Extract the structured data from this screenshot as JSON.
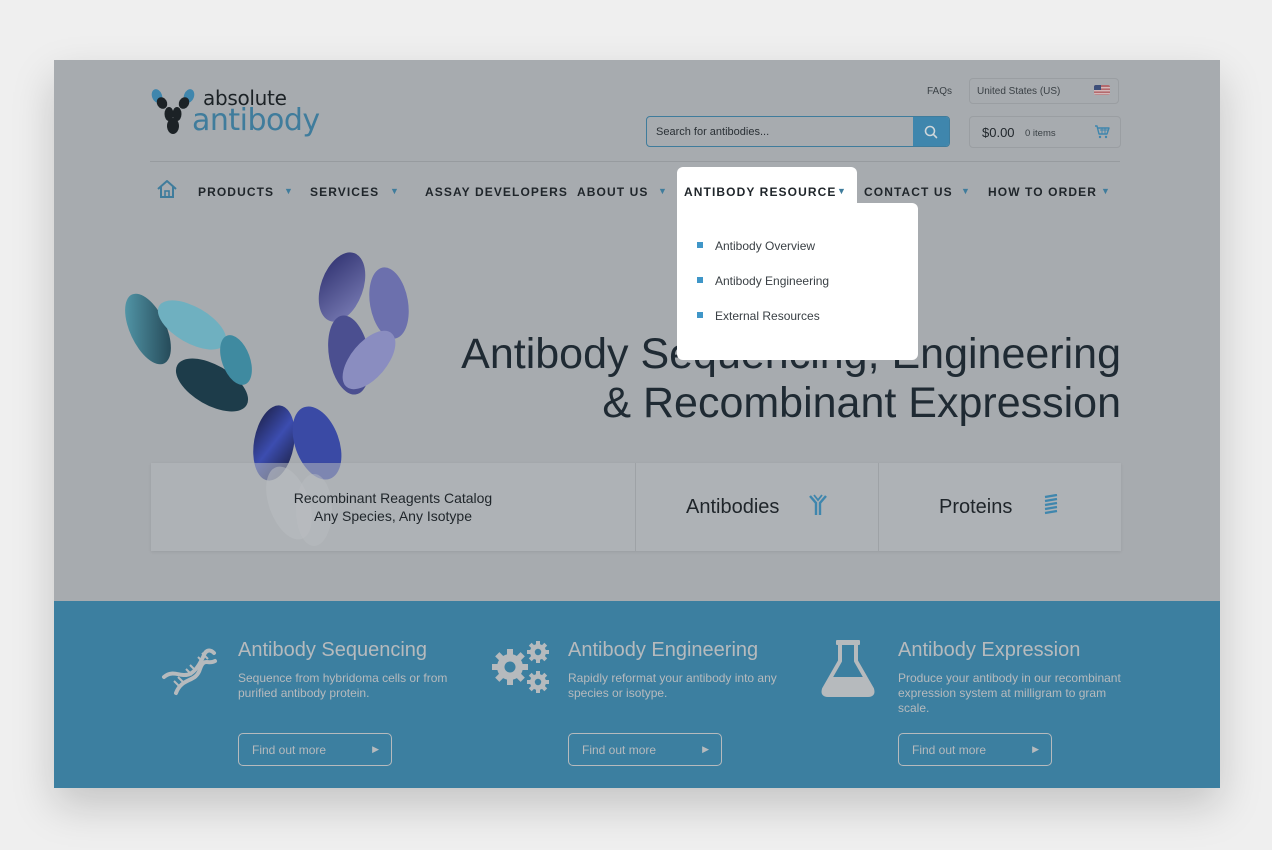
{
  "brand": {
    "word1": "absolute",
    "word2": "antibody",
    "accent_color": "#3f7c9c"
  },
  "header": {
    "faqs_link": "FAQs",
    "country_selector": "United States (US)",
    "search": {
      "placeholder": "Search for antibodies..."
    },
    "cart": {
      "total": "$0.00",
      "items": "0 items"
    }
  },
  "nav": {
    "items": [
      {
        "label": "PRODUCTS",
        "has_dropdown": true
      },
      {
        "label": "SERVICES",
        "has_dropdown": true
      },
      {
        "label": "ASSAY DEVELOPERS",
        "has_dropdown": false
      },
      {
        "label": "ABOUT US",
        "has_dropdown": true
      },
      {
        "label": "ANTIBODY RESOURCE",
        "has_dropdown": true,
        "active": true
      },
      {
        "label": "CONTACT US",
        "has_dropdown": true
      },
      {
        "label": "HOW TO ORDER",
        "has_dropdown": true
      }
    ],
    "caret": "▼",
    "dropdown": {
      "items": [
        "Antibody Overview",
        "Antibody Engineering",
        "External Resources"
      ]
    }
  },
  "hero": {
    "title_line1": "Antibody Sequencing, Engineering",
    "title_line2": "& Recombinant Expression"
  },
  "cards": [
    {
      "line1": "Recombinant Reagents Catalog",
      "line2": "Any Species, Any Isotype"
    },
    {
      "label": "Antibodies",
      "icon": "antibody-icon"
    },
    {
      "label": "Proteins",
      "icon": "protein-icon"
    }
  ],
  "services": [
    {
      "title": "Antibody Sequencing",
      "description": "Sequence from hybridoma cells or from purified antibody protein.",
      "button": "Find out more",
      "icon": "dna-icon"
    },
    {
      "title": "Antibody Engineering",
      "description": "Rapidly reformat your antibody into any species or isotype.",
      "button": "Find out more",
      "icon": "gears-icon"
    },
    {
      "title": "Antibody Expression",
      "description": "Produce your antibody in our recombinant expression system at milligram to gram scale.",
      "button": "Find out more",
      "icon": "flask-icon"
    }
  ],
  "button_arrow": "▶"
}
